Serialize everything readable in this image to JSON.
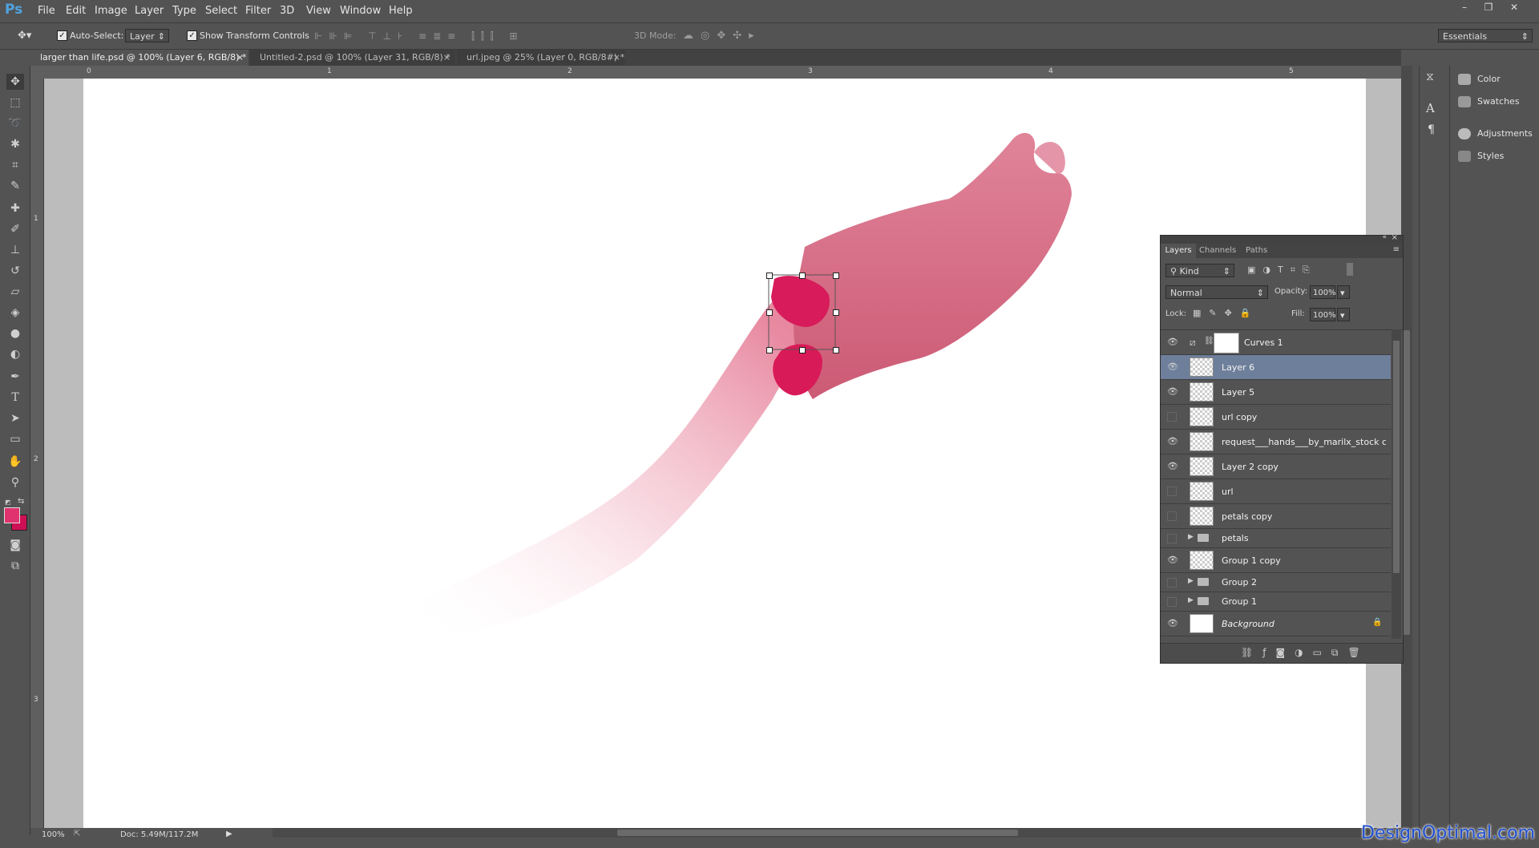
{
  "app": {
    "logo": "Ps",
    "menus": [
      "File",
      "Edit",
      "Image",
      "Layer",
      "Type",
      "Select",
      "Filter",
      "3D",
      "View",
      "Window",
      "Help"
    ],
    "window_controls": [
      "–",
      "❐",
      "✕"
    ]
  },
  "options_bar": {
    "auto_select_label": "Auto-Select:",
    "auto_select_checked": true,
    "auto_select_value": "Layer",
    "show_transform_label": "Show Transform Controls",
    "show_transform_checked": true,
    "mode_3d_label": "3D Mode:",
    "workspace": "Essentials"
  },
  "tabs": [
    {
      "label": "larger than life.psd @ 100% (Layer 6, RGB/8) *",
      "active": true
    },
    {
      "label": "Untitled-2.psd @ 100% (Layer 31, RGB/8) *",
      "active": false
    },
    {
      "label": "url.jpeg @ 25% (Layer 0, RGB/8#) *",
      "active": false
    }
  ],
  "ruler": {
    "h_labels": [
      "0",
      "1",
      "2",
      "3",
      "4",
      "5"
    ],
    "v_labels": [
      "1",
      "2",
      "3"
    ]
  },
  "tools": [
    "move-tool",
    "marquee-tool",
    "lasso-tool",
    "magic-wand-tool",
    "crop-tool",
    "eyedropper-tool",
    "healing-brush-tool",
    "brush-tool",
    "clone-stamp-tool",
    "history-brush-tool",
    "eraser-tool",
    "paint-bucket-tool",
    "blur-tool",
    "dodge-tool",
    "pen-tool",
    "type-tool",
    "path-selection-tool",
    "shape-tool",
    "hand-tool",
    "zoom-tool"
  ],
  "colors": {
    "foreground": "#e0326f",
    "background": "#cf0f55",
    "selected_layer": "#6e7f9b"
  },
  "right_panels": [
    {
      "label": "Color",
      "icon": "color-icon"
    },
    {
      "label": "Swatches",
      "icon": "swatches-icon"
    },
    {
      "label": "Adjustments",
      "icon": "adjustments-icon"
    },
    {
      "label": "Styles",
      "icon": "styles-icon"
    }
  ],
  "layers_panel": {
    "tabs": [
      "Layers",
      "Channels",
      "Paths"
    ],
    "filter": "Kind",
    "blend_mode": "Normal",
    "opacity_label": "Opacity:",
    "opacity": "100%",
    "lock_label": "Lock:",
    "fill_label": "Fill:",
    "fill": "100%",
    "layers": [
      {
        "name": "Curves 1",
        "visible": true,
        "type": "adjustment",
        "selected": false
      },
      {
        "name": "Layer 6",
        "visible": true,
        "type": "pixel",
        "selected": true
      },
      {
        "name": "Layer 5",
        "visible": true,
        "type": "pixel",
        "selected": false
      },
      {
        "name": "url copy",
        "visible": false,
        "type": "pixel",
        "selected": false
      },
      {
        "name": "request___hands___by_marilx_stock cop...",
        "visible": true,
        "type": "pixel",
        "selected": false
      },
      {
        "name": "Layer 2 copy",
        "visible": true,
        "type": "pixel",
        "selected": false
      },
      {
        "name": "url",
        "visible": false,
        "type": "pixel",
        "selected": false
      },
      {
        "name": "petals copy",
        "visible": false,
        "type": "pixel",
        "selected": false
      },
      {
        "name": "petals",
        "visible": false,
        "type": "group",
        "selected": false
      },
      {
        "name": "Group 1 copy",
        "visible": true,
        "type": "pixel",
        "selected": false
      },
      {
        "name": "Group 2",
        "visible": false,
        "type": "group",
        "selected": false
      },
      {
        "name": "Group 1",
        "visible": false,
        "type": "group",
        "selected": false
      },
      {
        "name": "Background",
        "visible": true,
        "type": "background",
        "selected": false
      }
    ]
  },
  "status": {
    "zoom": "100%",
    "doc": "Doc: 5.49M/117.2M"
  },
  "watermark": "DesignOptimal.com"
}
